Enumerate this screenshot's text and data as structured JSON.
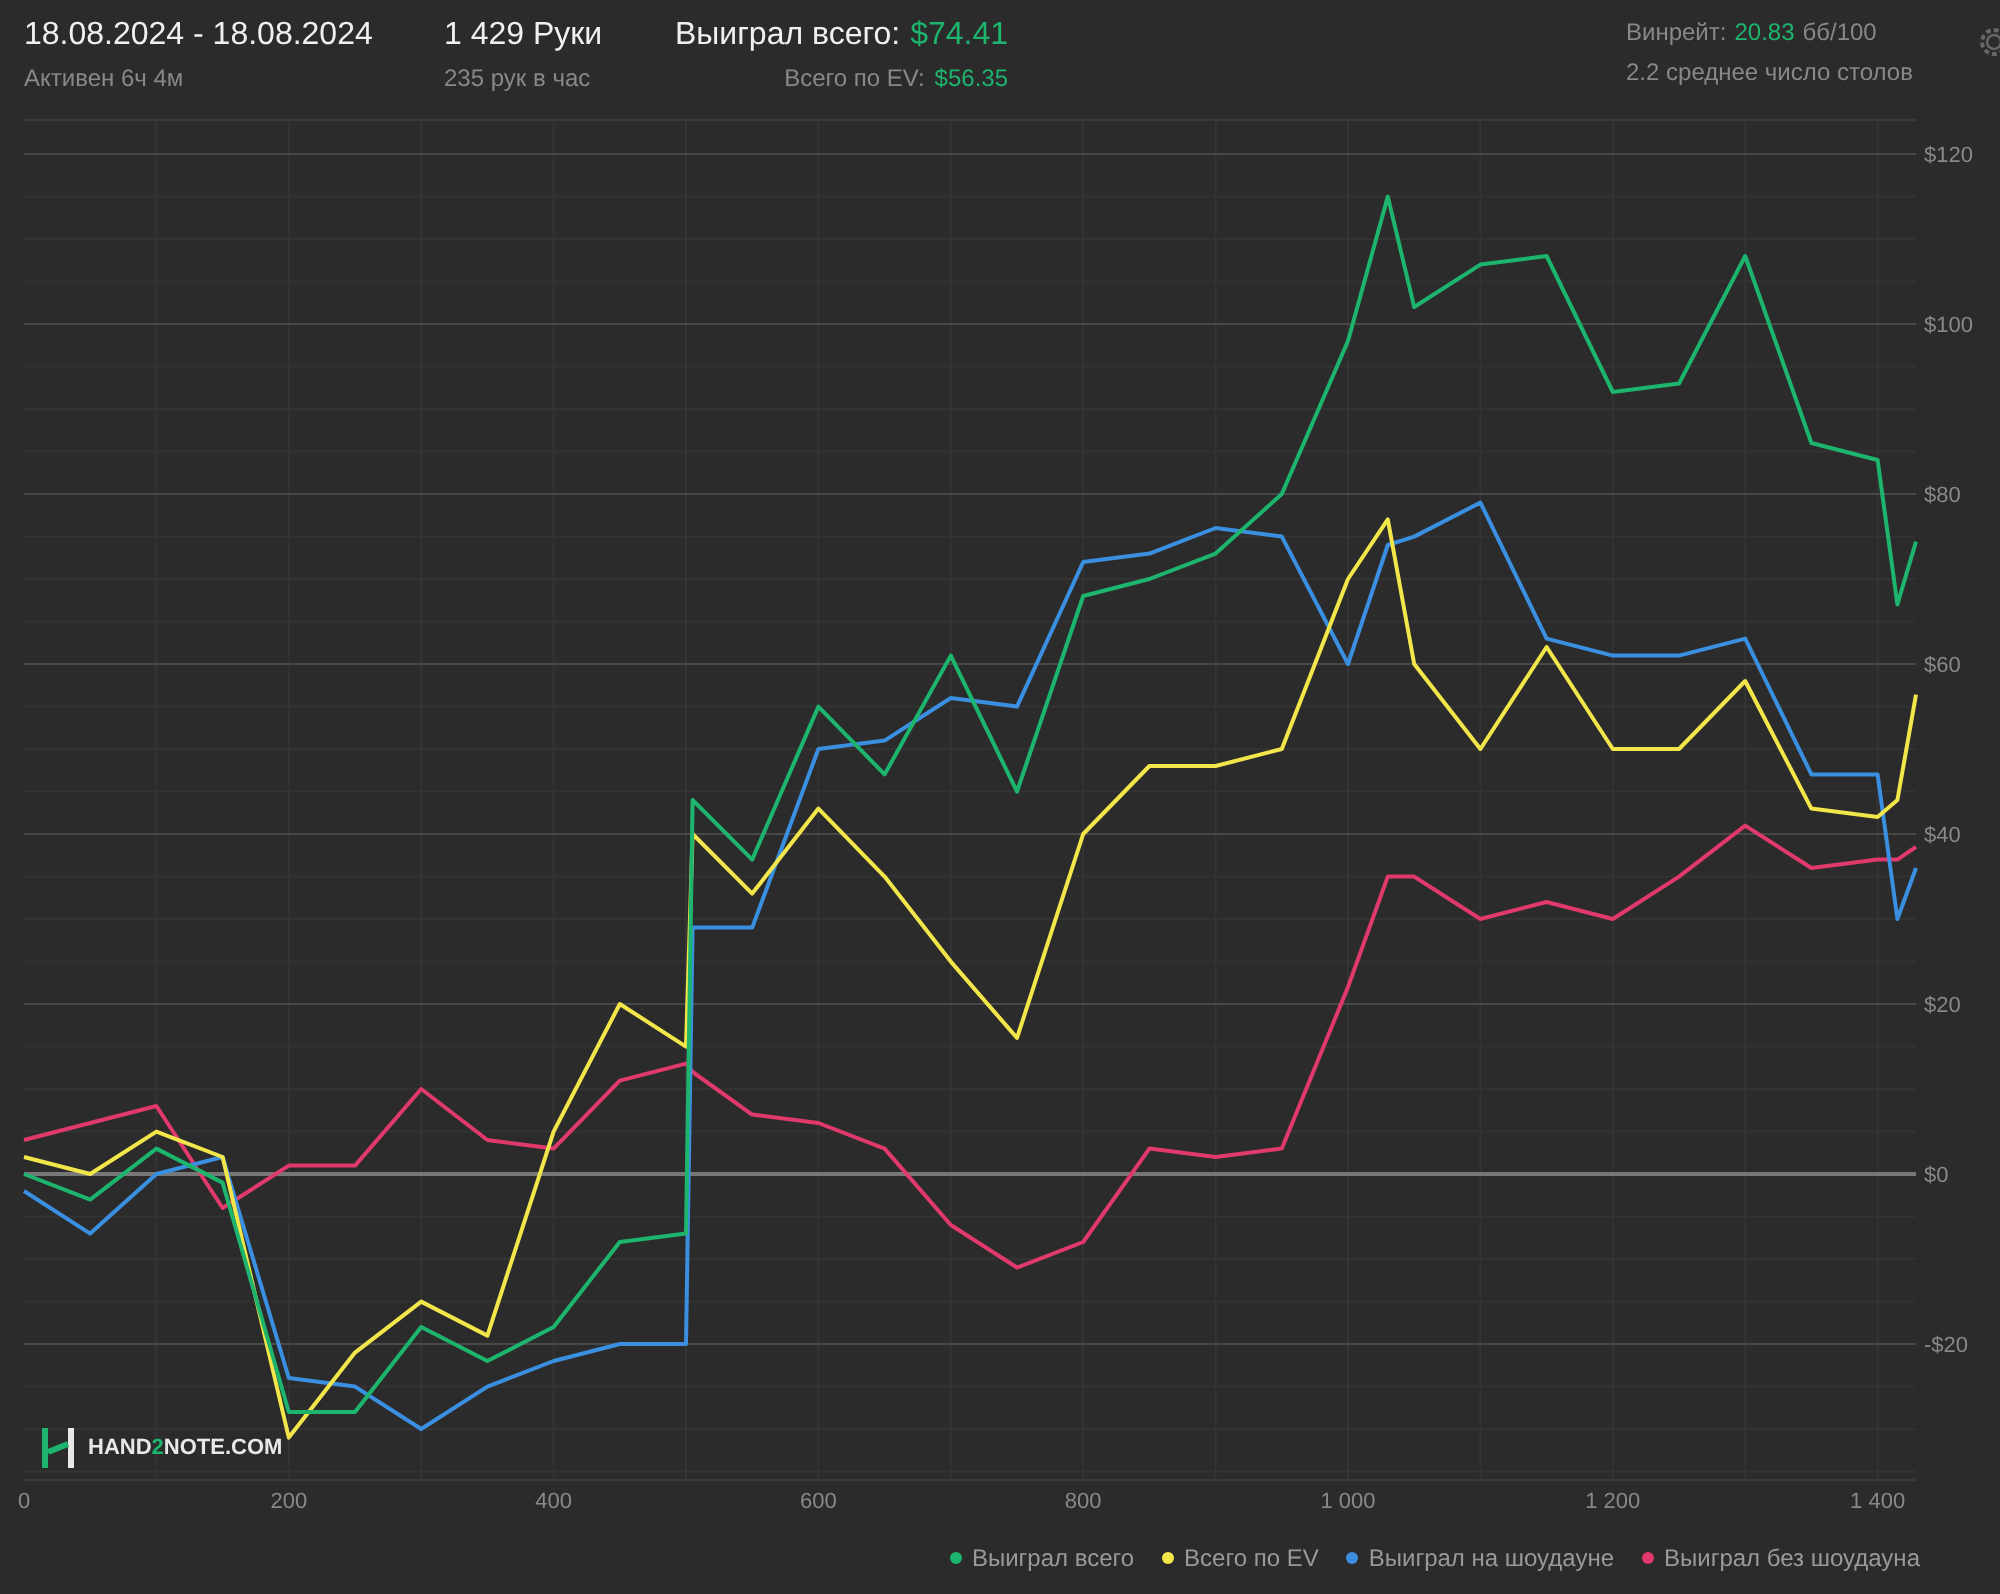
{
  "header": {
    "date_range": "18.08.2024 - 18.08.2024",
    "active_time": "Активен 6ч 4м",
    "hands": "1 429 Руки",
    "hands_per_hour": "235 рук в час",
    "won_total_label": "Выиграл всего:",
    "won_total_value": "$74.41",
    "ev_label": "Всего по EV:",
    "ev_value": "$56.35",
    "winrate_label": "Винрейт:",
    "winrate_value": "20.83",
    "winrate_unit": "бб/100",
    "avg_tables": "2.2 среднее число столов"
  },
  "chart": {
    "logo": "HAND**2**NOTE.COM",
    "chart_data": {
      "type": "line",
      "grid": true,
      "x": [
        0,
        50,
        100,
        150,
        200,
        250,
        300,
        350,
        400,
        450,
        500,
        505,
        550,
        600,
        650,
        700,
        750,
        800,
        850,
        900,
        950,
        1000,
        1030,
        1050,
        1100,
        1150,
        1200,
        1250,
        1300,
        1350,
        1400,
        1415,
        1429
      ],
      "xlim": [
        0,
        1429
      ],
      "ylim": [
        -36,
        124
      ],
      "xticks": [
        {
          "value": 0,
          "label": "0"
        },
        {
          "value": 200,
          "label": "200"
        },
        {
          "value": 400,
          "label": "400"
        },
        {
          "value": 600,
          "label": "600"
        },
        {
          "value": 800,
          "label": "800"
        },
        {
          "value": 1000,
          "label": "1 000"
        },
        {
          "value": 1200,
          "label": "1 200"
        },
        {
          "value": 1400,
          "label": "1 400"
        }
      ],
      "yticks": [
        {
          "value": 120,
          "label": "$120"
        },
        {
          "value": 100,
          "label": "$100"
        },
        {
          "value": 80,
          "label": "$80"
        },
        {
          "value": 60,
          "label": "$60"
        },
        {
          "value": 40,
          "label": "$40"
        },
        {
          "value": 20,
          "label": "$20"
        },
        {
          "value": 0,
          "label": "$0"
        },
        {
          "value": -20,
          "label": "-$20"
        }
      ],
      "series": [
        {
          "name": "Выиграл всего",
          "color": "#1db56e",
          "values": [
            0,
            -3,
            3,
            -1,
            -28,
            -28,
            -18,
            -22,
            -18,
            -8,
            -7,
            44,
            37,
            55,
            47,
            61,
            45,
            68,
            70,
            73,
            80,
            98,
            115,
            102,
            107,
            108,
            92,
            93,
            108,
            86,
            84,
            67,
            74.4
          ]
        },
        {
          "name": "Всего по EV",
          "color": "#f2e64a",
          "values": [
            2,
            0,
            5,
            2,
            -31,
            -21,
            -15,
            -19,
            5,
            20,
            15,
            40,
            33,
            43,
            35,
            25,
            16,
            40,
            48,
            48,
            50,
            70,
            77,
            60,
            50,
            62,
            50,
            50,
            58,
            43,
            42,
            44,
            56.4
          ]
        },
        {
          "name": "Выиграл на шоудауне",
          "color": "#3b8fe0",
          "values": [
            -2,
            -7,
            0,
            2,
            -24,
            -25,
            -30,
            -25,
            -22,
            -20,
            -20,
            29,
            29,
            50,
            51,
            56,
            55,
            72,
            73,
            76,
            75,
            60,
            74,
            75,
            79,
            63,
            61,
            61,
            63,
            47,
            47,
            30,
            36
          ]
        },
        {
          "name": "Выиграл без шоудауна",
          "color": "#e0396b",
          "values": [
            4,
            6,
            8,
            -4,
            1,
            1,
            10,
            4,
            3,
            11,
            13,
            12,
            7,
            6,
            3,
            -6,
            -11,
            -8,
            3,
            2,
            3,
            22,
            35,
            35,
            30,
            32,
            30,
            35,
            41,
            36,
            37,
            37,
            38.5
          ]
        }
      ]
    }
  }
}
